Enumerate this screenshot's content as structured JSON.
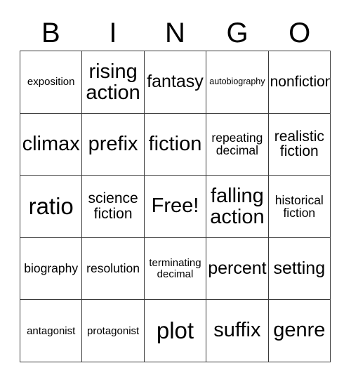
{
  "card": {
    "title_letters": [
      "B",
      "I",
      "N",
      "G",
      "O"
    ],
    "free_space": "Free!",
    "rows": [
      [
        {
          "label": "exposition",
          "size": "sm"
        },
        {
          "label": "rising\naction",
          "size": "xxl"
        },
        {
          "label": "fantasy",
          "size": "xl"
        },
        {
          "label": "autobiography",
          "size": "xs"
        },
        {
          "label": "nonfiction",
          "size": "lg"
        }
      ],
      [
        {
          "label": "climax",
          "size": "xxl"
        },
        {
          "label": "prefix",
          "size": "xxl"
        },
        {
          "label": "fiction",
          "size": "xxl"
        },
        {
          "label": "repeating\ndecimal",
          "size": "md"
        },
        {
          "label": "realistic\nfiction",
          "size": "lg"
        }
      ],
      [
        {
          "label": "ratio",
          "size": "huge"
        },
        {
          "label": "science\nfiction",
          "size": "lg"
        },
        {
          "label": "Free!",
          "size": "xxl"
        },
        {
          "label": "falling\naction",
          "size": "xxl"
        },
        {
          "label": "historical\nfiction",
          "size": "md"
        }
      ],
      [
        {
          "label": "biography",
          "size": "md"
        },
        {
          "label": "resolution",
          "size": "md"
        },
        {
          "label": "terminating\ndecimal",
          "size": "sm"
        },
        {
          "label": "percent",
          "size": "xl"
        },
        {
          "label": "setting",
          "size": "xl"
        }
      ],
      [
        {
          "label": "antagonist",
          "size": "sm"
        },
        {
          "label": "protagonist",
          "size": "sm"
        },
        {
          "label": "plot",
          "size": "huge"
        },
        {
          "label": "suffix",
          "size": "xxl"
        },
        {
          "label": "genre",
          "size": "xxl"
        }
      ]
    ]
  },
  "colors": {
    "background": "#ffffff",
    "text": "#000000",
    "grid_line": "#3a3a3a"
  }
}
